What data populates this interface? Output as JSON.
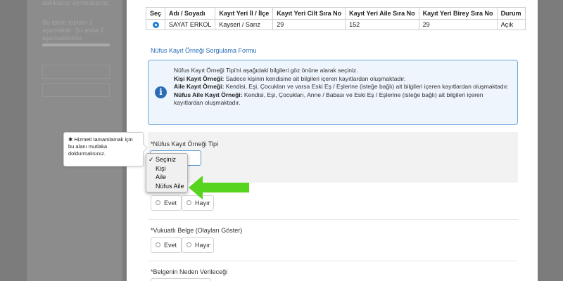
{
  "sidebar": {
    "line1": "dakikanızı ayırmalısınız.",
    "progress_text_1": "Bu işlem toplam 3",
    "progress_text_2": "aşamalıdır. Şu anda 2.",
    "progress_text_3": "aşamadasınız.",
    "progress_current": 2,
    "progress_total": 3
  },
  "results_table": {
    "headers": [
      "Seç",
      "Adı / Soyadı",
      "Kayıt Yeri İl / İlçe",
      "Kayıt Yeri Cilt Sıra No",
      "Kayıt Yeri Aile Sıra No",
      "Kayıt Yeri Birey Sıra No",
      "Durum"
    ],
    "rows": [
      [
        "",
        "SAYAT ERKOL",
        "Kayseri / Sarız",
        "29",
        "152",
        "29",
        "Açık"
      ]
    ]
  },
  "form": {
    "title": "Nüfus Kayıt Örneği Sorgulama Formu",
    "info": {
      "intro": "Nüfus Kayıt Örneği Tipi'ni aşağıdaki bilgileri göz önüne alarak seçiniz.",
      "kisi_label": "Kişi Kayıt Örneği:",
      "kisi_text": " Sadece kişinin kendisine ait bilgileri içeren kayıtlardan oluşmaktadır.",
      "aile_label": "Aile Kayıt Örneği:",
      "aile_text": " Kendisi, Eşi, Çocukları ve varsa Eski Eş / Eşlerine (isteğe bağlı) ait bilgileri içeren kayıtlardan oluşmaktadır.",
      "nufus_label": "Nüfus Aile Kayıt Örneği:",
      "nufus_text": " Kendisi, Eşi, Çocukları, Anne / Babası ve Eski Eş / Eşlerine (isteğe bağlı) ait bilgileri içeren kayıtlardan oluşmaktadır."
    },
    "type_label": "*Nüfus Kayıt Örneği Tipi",
    "evet": "Evet",
    "hayir": "Hayır",
    "vukuatli_label": "*Vukuatlı Belge (Olayları Göster)",
    "neden_label": "*Belgenin Neden Verileceği"
  },
  "tooltip": {
    "text": "Hizmeti tamamlamak için bu alanı mutlaka doldurmalısınız."
  },
  "dropdown": {
    "options": [
      "Seçiniz",
      "Kişi",
      "Aile",
      "Nüfus Aile"
    ],
    "selected": "Seçiniz",
    "check": "✓"
  },
  "colors": {
    "accent": "#2a6fb8",
    "arrow": "#57d41e"
  }
}
